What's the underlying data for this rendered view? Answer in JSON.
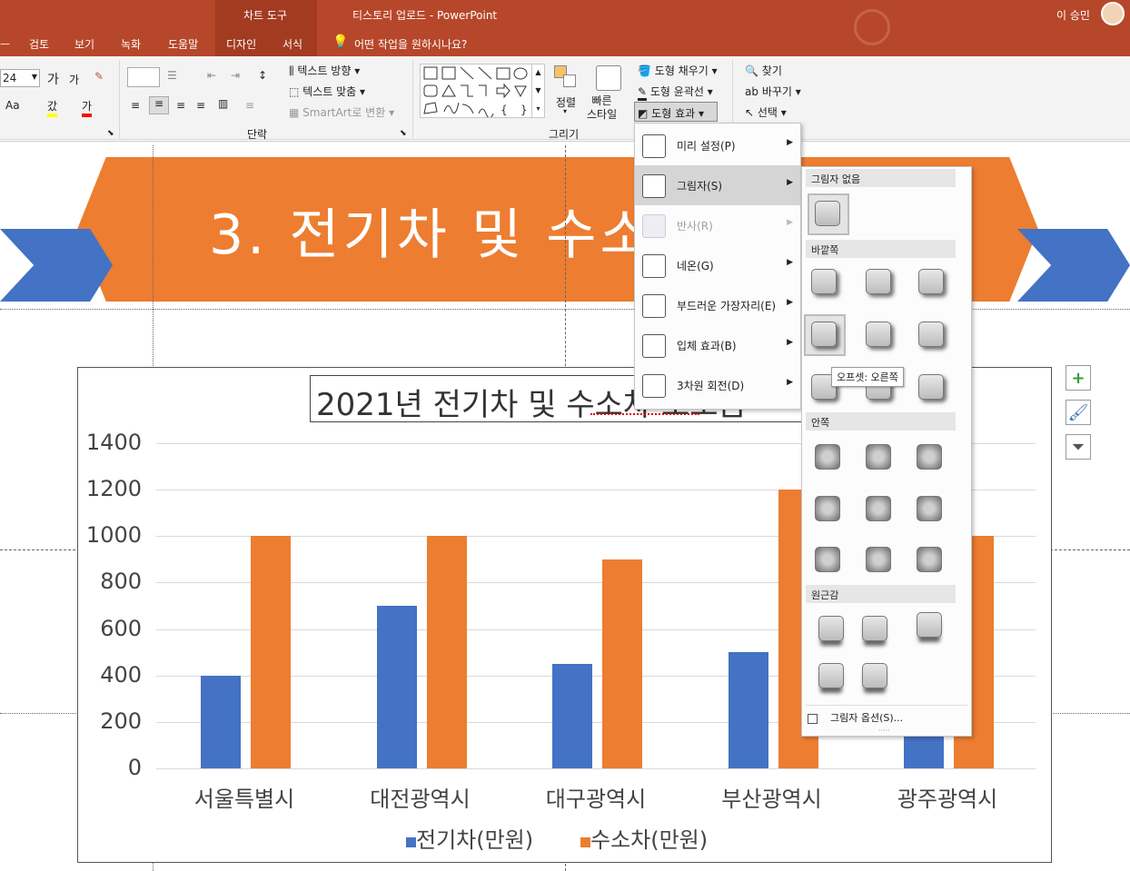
{
  "titlebar": {
    "context_tools": "차트 도구",
    "title": "티스토리 업로드  -  PowerPoint",
    "user": "이 승민"
  },
  "tabs": [
    "검토",
    "보기",
    "녹화",
    "도움말",
    "디자인",
    "서식"
  ],
  "tell_me": "어떤 작업을 원하시나요?",
  "ribbon": {
    "font_size": "24",
    "grow_font": "가",
    "shrink_font": "가",
    "aa": "Aa",
    "highlight": "갔",
    "font_color": "가",
    "text_direction": "텍스트 방향",
    "align_text": "텍스트 맞춤",
    "smartart": "SmartArt로 변환",
    "paragraph_group": "단락",
    "arrange": "정렬",
    "quick_styles": "빠른\n스타일",
    "shape_fill": "도형 채우기",
    "shape_outline": "도형 윤곽선",
    "shape_effects": "도형 효과",
    "drawing_group": "그리기",
    "find": "찾기",
    "replace": "바꾸기",
    "select": "선택"
  },
  "slide_title": "3. 전기차 및 수소",
  "effects_menu": [
    {
      "label": "미리 설정(P)",
      "enabled": true
    },
    {
      "label": "그림자(S)",
      "enabled": true,
      "hover": true
    },
    {
      "label": "반사(R)",
      "enabled": false
    },
    {
      "label": "네온(G)",
      "enabled": true
    },
    {
      "label": "부드러운 가장자리(E)",
      "enabled": true
    },
    {
      "label": "입체 효과(B)",
      "enabled": true
    },
    {
      "label": "3차원 회전(D)",
      "enabled": true
    }
  ],
  "shadow_submenu": {
    "no_shadow": "그림자 없음",
    "outer": "바깥쪽",
    "inner": "안쪽",
    "perspective": "원근감",
    "options": "그림자 옵션(S)...",
    "tooltip": "오프셋: 오른쪽"
  },
  "colors": {
    "titlebar": "#b7472a",
    "orange": "#ed7d31",
    "blue": "#4472c4"
  },
  "chart_data": {
    "type": "bar",
    "title": "2021년 전기차 및 수소차 보조금",
    "categories": [
      "서울특별시",
      "대전광역시",
      "대구광역시",
      "부산광역시",
      "광주광역시"
    ],
    "series": [
      {
        "name": "전기차(만원)",
        "values": [
          400,
          700,
          450,
          500,
          400
        ],
        "color": "#4472c4"
      },
      {
        "name": "수소차(만원)",
        "values": [
          1000,
          1000,
          900,
          1200,
          1000
        ],
        "color": "#ed7d31"
      }
    ],
    "yticks": [
      "1400",
      "1200",
      "1000",
      "800",
      "600",
      "400",
      "200",
      "0"
    ],
    "ylim": [
      0,
      1400
    ],
    "grid": true,
    "legend": "bottom"
  }
}
